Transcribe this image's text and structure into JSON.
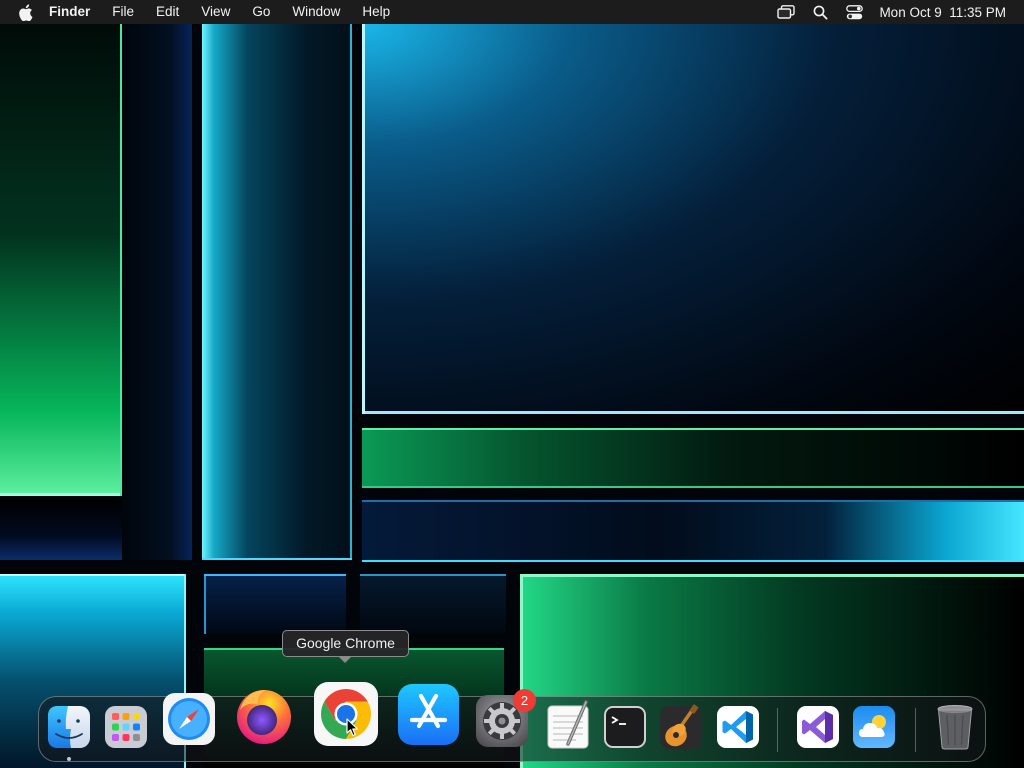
{
  "menubar": {
    "app_name": "Finder",
    "menus": [
      "File",
      "Edit",
      "View",
      "Go",
      "Window",
      "Help"
    ],
    "clock": "Mon Oct 9  11:35 PM",
    "status_icons": [
      "screen-mirroring-icon",
      "search-icon",
      "control-center-icon"
    ]
  },
  "tooltip": {
    "text": "Google Chrome"
  },
  "dock": {
    "items": [
      {
        "name": "finder",
        "icon": "finder-icon",
        "running": true
      },
      {
        "name": "launchpad",
        "icon": "launchpad-icon",
        "running": false
      },
      {
        "name": "safari",
        "icon": "safari-icon",
        "running": false
      },
      {
        "name": "firefox",
        "icon": "firefox-icon",
        "running": false
      },
      {
        "name": "google-chrome",
        "icon": "chrome-icon",
        "running": false,
        "hovered": true
      },
      {
        "name": "app-store",
        "icon": "app-store-icon",
        "running": false
      },
      {
        "name": "system-settings",
        "icon": "gear-icon",
        "running": false,
        "badge": "2"
      },
      {
        "name": "textedit",
        "icon": "textedit-icon",
        "running": false
      },
      {
        "name": "terminal",
        "icon": "terminal-icon",
        "running": false
      },
      {
        "name": "garageband",
        "icon": "guitar-icon",
        "running": false
      },
      {
        "name": "visual-studio-code",
        "icon": "vscode-icon",
        "running": false
      },
      {
        "name": "visual-studio",
        "icon": "visual-studio-icon",
        "running": false
      },
      {
        "name": "weather",
        "icon": "weather-icon",
        "running": false
      },
      {
        "name": "trash",
        "icon": "trash-icon",
        "running": false
      }
    ],
    "badge_count": "2"
  },
  "colors": {
    "menubar_bg": "#1e1e20",
    "badge": "#ef3b34",
    "wallpaper_cyan": "#38e0ff",
    "wallpaper_green": "#00c060"
  }
}
